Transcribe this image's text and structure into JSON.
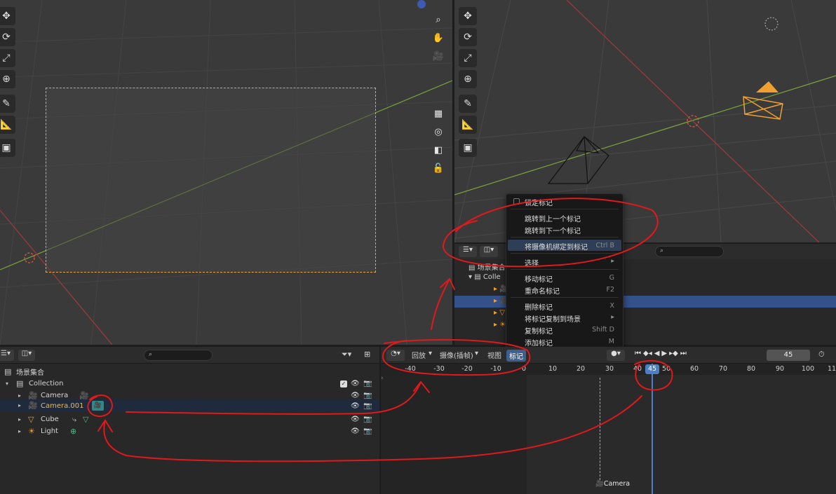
{
  "left_viewport": {
    "tools": [
      "move-icon",
      "rotate-icon",
      "scale-icon",
      "transform-icon",
      "annotate-icon",
      "measure-icon",
      "add-cube-icon"
    ],
    "nav_buttons": [
      "zoom-icon",
      "hand-icon",
      "camera-icon",
      "grid-icon",
      "camera-persp-icon",
      "toggle-icon",
      "lock-icon"
    ]
  },
  "context_menu": {
    "items": [
      {
        "label": "锁定标记",
        "shortcut": ""
      },
      {
        "label": "跳转到上一个标记",
        "shortcut": ""
      },
      {
        "label": "跳转到下一个标记",
        "shortcut": ""
      },
      {
        "label": "将摄像机绑定到标记",
        "shortcut": "Ctrl B"
      },
      {
        "label": "选择",
        "shortcut": ""
      },
      {
        "label": "移动标记",
        "shortcut": "G"
      },
      {
        "label": "重命名标记",
        "shortcut": "F2"
      },
      {
        "label": "删除标记",
        "shortcut": "X"
      },
      {
        "label": "将标记复制到场景",
        "shortcut": ""
      },
      {
        "label": "复制标记",
        "shortcut": "Shift D"
      },
      {
        "label": "添加标记",
        "shortcut": "M"
      }
    ]
  },
  "outliner": {
    "scene_collection": "场景集合",
    "collection": "Collection",
    "rows": [
      {
        "name": "Camera"
      },
      {
        "name": "Camera.001"
      },
      {
        "name": "Cube"
      },
      {
        "name": "Light"
      }
    ]
  },
  "outliner_mid": {
    "scene_collection": "场景集合",
    "collection_short": "Colle"
  },
  "timeline": {
    "menus": [
      "回放",
      "摄像(插帧)",
      "视图",
      "标记"
    ],
    "current_frame": "45",
    "ruler_ticks": [
      "-40",
      "-30",
      "-20",
      "-10",
      "0",
      "10",
      "20",
      "30",
      "40",
      "50",
      "60",
      "70",
      "80",
      "90",
      "100",
      "11"
    ],
    "marker_label": "Camera"
  },
  "colors": {
    "accent": "#4d7fc7",
    "camera_frame": "#e6a93b",
    "annotation": "#e0191c"
  }
}
